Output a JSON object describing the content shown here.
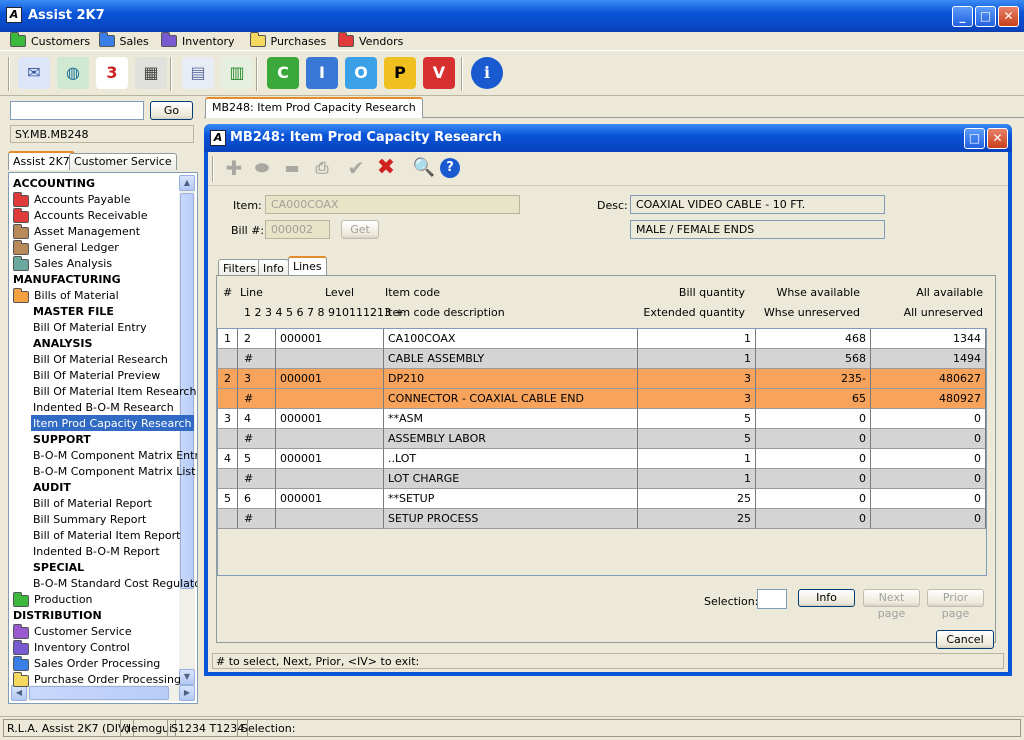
{
  "app": {
    "title": "Assist 2K7"
  },
  "menu": [
    {
      "label": "Customers",
      "color": "#3cb83c"
    },
    {
      "label": "Sales",
      "color": "#3a7ee8"
    },
    {
      "label": "Inventory",
      "color": "#7a5ad0"
    },
    {
      "label": "Purchases",
      "color": "#f4d860"
    },
    {
      "label": "Vendors",
      "color": "#e03a3a"
    }
  ],
  "toolbar_icons": [
    {
      "name": "mail-icon",
      "glyph": "✉",
      "bg": "#dde6f8",
      "fg": "#3050a0"
    },
    {
      "name": "globe-icon",
      "glyph": "◍",
      "bg": "#cfe8d0",
      "fg": "#1a6a9a"
    },
    {
      "name": "calendar-icon",
      "glyph": "3",
      "bg": "#fff",
      "fg": "#d02020"
    },
    {
      "name": "calculator-icon",
      "glyph": "▦",
      "bg": "#e0e0dc",
      "fg": "#444"
    },
    {
      "name": "report-icon",
      "glyph": "▤",
      "bg": "#e8ecf4",
      "fg": "#6070a0"
    },
    {
      "name": "export-icon",
      "glyph": "▥",
      "bg": "#e6f0e0",
      "fg": "#2a8a2a"
    },
    {
      "name": "customers-c-icon",
      "glyph": "C",
      "bg": "#3aa83a",
      "fg": "#fff"
    },
    {
      "name": "inventory-i-icon",
      "glyph": "I",
      "bg": "#3a78d8",
      "fg": "#fff"
    },
    {
      "name": "orders-o-icon",
      "glyph": "O",
      "bg": "#3aa0e8",
      "fg": "#fff"
    },
    {
      "name": "purchases-p-icon",
      "glyph": "P",
      "bg": "#f0c020",
      "fg": "#000"
    },
    {
      "name": "vendors-v-icon",
      "glyph": "V",
      "bg": "#d83030",
      "fg": "#fff"
    },
    {
      "name": "info-icon",
      "glyph": "i",
      "bg": "#1a5ad0",
      "fg": "#fff"
    }
  ],
  "left": {
    "search_value": "",
    "go_label": "Go",
    "path": "SY.MB.MB248",
    "tabs": [
      "Assist 2K7",
      "Customer Service"
    ],
    "tree": [
      {
        "t": "ACCOUNTING",
        "k": "h"
      },
      {
        "t": "Accounts Payable",
        "k": "f",
        "c": "#e03a3a"
      },
      {
        "t": "Accounts Receivable",
        "k": "f",
        "c": "#e03a3a"
      },
      {
        "t": "Asset Management",
        "k": "f",
        "c": "#b88a5a"
      },
      {
        "t": "General Ledger",
        "k": "f",
        "c": "#b88a5a"
      },
      {
        "t": "Sales Analysis",
        "k": "f",
        "c": "#6aa8a0"
      },
      {
        "t": "MANUFACTURING",
        "k": "h"
      },
      {
        "t": "Bills of Material",
        "k": "f",
        "c": "#f4a040"
      },
      {
        "t": "MASTER FILE",
        "k": "s"
      },
      {
        "t": "Bill Of Material Entry",
        "k": "i"
      },
      {
        "t": "ANALYSIS",
        "k": "s"
      },
      {
        "t": "Bill Of Material Research",
        "k": "i"
      },
      {
        "t": "Bill Of Material Preview",
        "k": "i"
      },
      {
        "t": "Bill Of Material Item Research",
        "k": "i"
      },
      {
        "t": "Indented B-O-M Research",
        "k": "i"
      },
      {
        "t": "Item Prod Capacity Research",
        "k": "sel"
      },
      {
        "t": "SUPPORT",
        "k": "s"
      },
      {
        "t": "B-O-M Component Matrix Entry",
        "k": "i"
      },
      {
        "t": "B-O-M Component Matrix List",
        "k": "i"
      },
      {
        "t": "AUDIT",
        "k": "s"
      },
      {
        "t": "Bill of Material Report",
        "k": "i"
      },
      {
        "t": "Bill Summary Report",
        "k": "i"
      },
      {
        "t": "Bill of Material Item Report",
        "k": "i"
      },
      {
        "t": "Indented B-O-M Report",
        "k": "i"
      },
      {
        "t": "SPECIAL",
        "k": "s"
      },
      {
        "t": "B-O-M Standard Cost Regulato",
        "k": "i"
      },
      {
        "t": "Production",
        "k": "f",
        "c": "#3cb83c"
      },
      {
        "t": "DISTRIBUTION",
        "k": "h"
      },
      {
        "t": "Customer Service",
        "k": "f",
        "c": "#9a5ad0"
      },
      {
        "t": "Inventory Control",
        "k": "f",
        "c": "#7a5ad0"
      },
      {
        "t": "Sales Order Processing",
        "k": "f",
        "c": "#3a7ee8"
      },
      {
        "t": "Purchase Order Processing",
        "k": "f",
        "c": "#f4d860"
      }
    ]
  },
  "main_tab": "MB248: Item Prod Capacity Research",
  "window": {
    "title": "MB248: Item Prod Capacity Research",
    "item_label": "Item:",
    "item_value": "CA000COAX",
    "bill_label": "Bill #:",
    "bill_value": "000002",
    "get_label": "Get",
    "desc_label": "Desc:",
    "desc1": "COAXIAL VIDEO CABLE - 10 FT.",
    "desc2": "MALE / FEMALE ENDS",
    "tabs": [
      "Filters",
      "Info",
      "Lines"
    ],
    "headers": {
      "h1": "#",
      "h2": "Line",
      "h3": "Level",
      "h3b": "1 2 3 4 5 6 7 8 910111213 +",
      "h4": "Item code",
      "h4b": "Item code description",
      "h5": "Bill quantity",
      "h5b": "Extended quantity",
      "h6": "Whse available",
      "h6b": "Whse unreserved",
      "h7": "All available",
      "h7b": "All unreserved"
    },
    "rows": [
      {
        "s": "w",
        "c": [
          "1",
          "2",
          "000001",
          "CA100COAX",
          "1",
          "468",
          "1344"
        ]
      },
      {
        "s": "g",
        "c": [
          "",
          "#",
          "",
          "CABLE ASSEMBLY",
          "1",
          "568",
          "1494"
        ]
      },
      {
        "s": "o",
        "c": [
          "2",
          "3",
          "000001",
          "DP210",
          "3",
          "235-",
          "480627"
        ]
      },
      {
        "s": "o",
        "c": [
          "",
          "#",
          "",
          "CONNECTOR - COAXIAL CABLE END",
          "3",
          "65",
          "480927"
        ]
      },
      {
        "s": "w",
        "c": [
          "3",
          "4",
          "000001",
          "**ASM",
          "5",
          "0",
          "0"
        ]
      },
      {
        "s": "g",
        "c": [
          "",
          "#",
          "",
          "ASSEMBLY LABOR",
          "5",
          "0",
          "0"
        ]
      },
      {
        "s": "w",
        "c": [
          "4",
          "5",
          "000001",
          "..LOT",
          "1",
          "0",
          "0"
        ]
      },
      {
        "s": "g",
        "c": [
          "",
          "#",
          "",
          "LOT CHARGE",
          "1",
          "0",
          "0"
        ]
      },
      {
        "s": "w",
        "c": [
          "5",
          "6",
          "000001",
          "**SETUP",
          "25",
          "0",
          "0"
        ]
      },
      {
        "s": "g",
        "c": [
          "",
          "#",
          "",
          "SETUP PROCESS",
          "25",
          "0",
          "0"
        ]
      }
    ],
    "selection_label": "Selection:",
    "selection_value": "",
    "info_label": "Info",
    "next_label": "Next page",
    "prior_label": "Prior page",
    "cancel_label": "Cancel",
    "status": "# to select,  Next,  Prior,  <IV> to exit:"
  },
  "statusbar": [
    "R.L.A. Assist 2K7 (DIV)",
    "demogui",
    "S1234 T1234",
    "Selection:"
  ]
}
